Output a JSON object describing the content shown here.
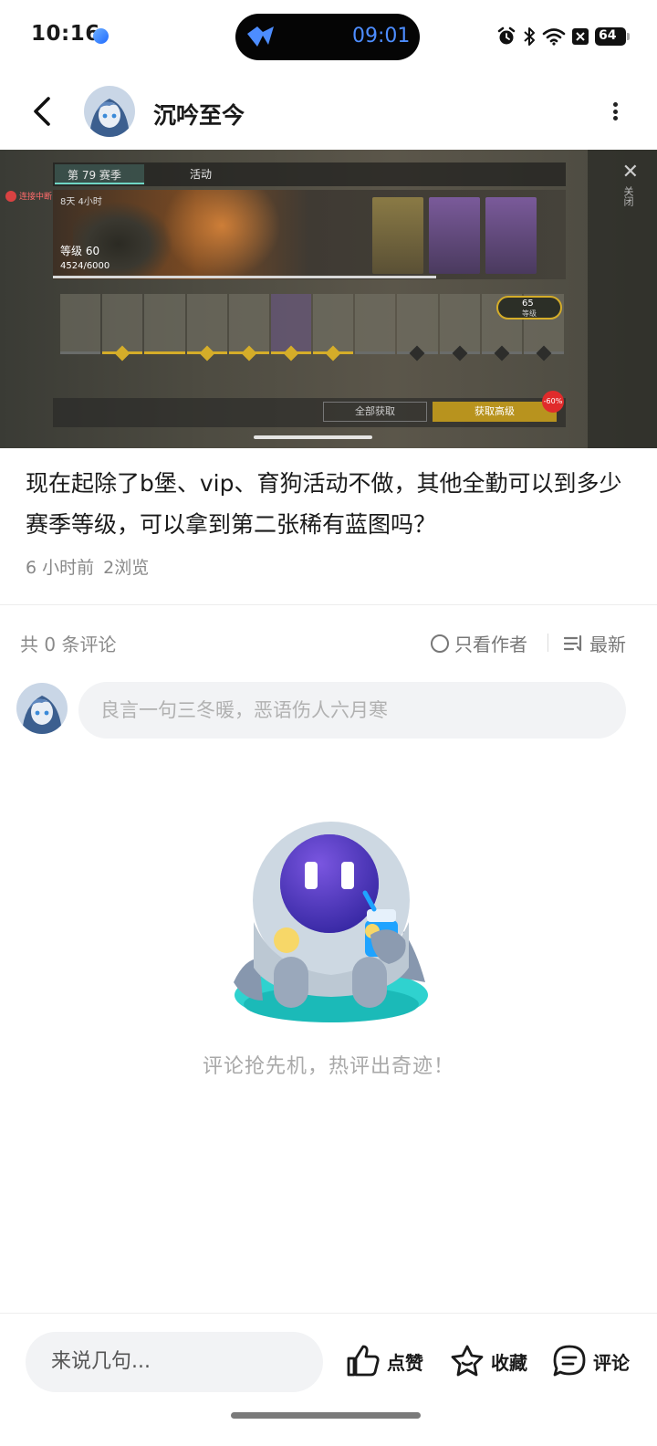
{
  "status_bar": {
    "time": "10:16",
    "island_time": "09:01",
    "battery": "64",
    "icons": [
      "alarm-icon",
      "bluetooth-icon",
      "wifi-icon",
      "notification-icon",
      "battery-icon"
    ]
  },
  "header": {
    "author_name": "沉吟至今"
  },
  "media": {
    "season_tab": "第 79 赛季",
    "activity_tab": "活动",
    "network_warning": "连接中断",
    "timer": "8天 4小时",
    "level": "等级 60",
    "xp": "4524/6000",
    "next_level": "65",
    "next_level_label": "等级",
    "claim_all": "全部获取",
    "unlock_advanced": "获取高级",
    "discount": "-60%",
    "close_label": "关闭"
  },
  "post": {
    "text": "现在起除了b堡、vip、育狗活动不做，其他全勤可以到多少赛季等级，可以拿到第二张稀有蓝图吗？",
    "time_ago": "6 小时前",
    "views": "2浏览"
  },
  "comments": {
    "count_label": "共 0 条评论",
    "only_author": "只看作者",
    "sort": "最新",
    "input_placeholder": "良言一句三冬暖，恶语伤人六月寒",
    "empty_text": "评论抢先机，热评出奇迹！"
  },
  "bottom_bar": {
    "reply_placeholder": "来说几句...",
    "like": "点赞",
    "favorite": "收藏",
    "comment": "评论"
  },
  "colors": {
    "island_accent": "#4d8dff",
    "gold": "#d5ad29",
    "muted_text": "#888888"
  }
}
